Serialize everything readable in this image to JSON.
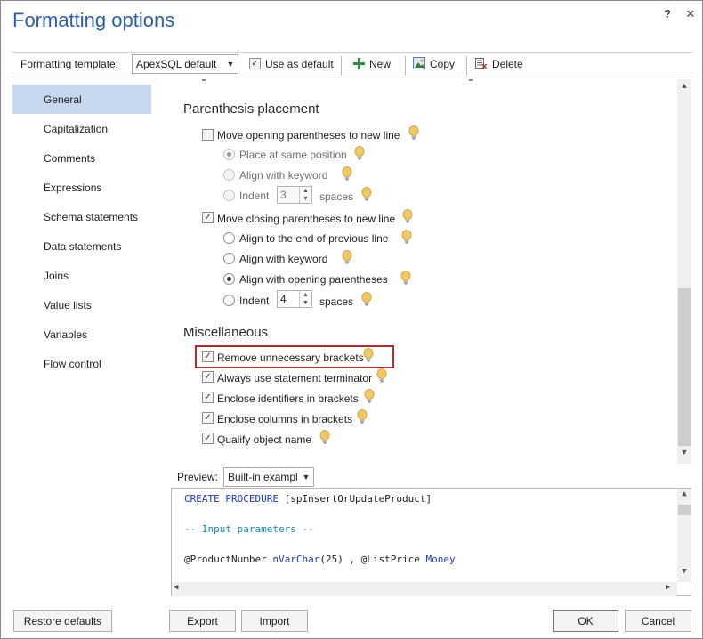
{
  "dialog": {
    "title": "Formatting options",
    "help_label": "?",
    "close_label": "✕"
  },
  "toolbar": {
    "template_label": "Formatting template:",
    "template_value": "ApexSQL default",
    "use_as_default_label": "Use as default",
    "use_as_default_checked": true,
    "new_label": "New",
    "copy_label": "Copy",
    "delete_label": "Delete"
  },
  "sidebar": {
    "items": [
      {
        "label": "General",
        "active": true
      },
      {
        "label": "Capitalization",
        "active": false
      },
      {
        "label": "Comments",
        "active": false
      },
      {
        "label": "Expressions",
        "active": false
      },
      {
        "label": "Schema statements",
        "active": false
      },
      {
        "label": "Data statements",
        "active": false
      },
      {
        "label": "Joins",
        "active": false
      },
      {
        "label": "Value lists",
        "active": false
      },
      {
        "label": "Variables",
        "active": false
      },
      {
        "label": "Flow control",
        "active": false
      }
    ]
  },
  "parenthesis": {
    "title": "Parenthesis placement",
    "open_new_line": {
      "label": "Move opening parentheses to new line",
      "checked": false
    },
    "open_same_position": {
      "label": "Place at same position",
      "selected": true,
      "disabled": true
    },
    "open_align_keyword": {
      "label": "Align with keyword",
      "selected": false,
      "disabled": true
    },
    "open_indent": {
      "label": "Indent",
      "value": "3",
      "unit": "spaces",
      "selected": false,
      "disabled": true
    },
    "close_new_line": {
      "label": "Move closing parentheses to new line",
      "checked": true
    },
    "close_end_prev_line": {
      "label": "Align to the end of previous line",
      "selected": false
    },
    "close_align_keyword": {
      "label": "Align with keyword",
      "selected": false
    },
    "close_align_opening": {
      "label": "Align with opening parentheses",
      "selected": true
    },
    "close_indent": {
      "label": "Indent",
      "value": "4",
      "unit": "spaces",
      "selected": false
    }
  },
  "misc": {
    "title": "Miscellaneous",
    "options": [
      {
        "label": "Remove unnecessary brackets",
        "checked": true
      },
      {
        "label": "Always use statement terminator",
        "checked": true
      },
      {
        "label": "Enclose identifiers in brackets",
        "checked": true
      },
      {
        "label": "Enclose columns in brackets",
        "checked": true
      },
      {
        "label": "Qualify object name",
        "checked": true
      }
    ]
  },
  "preview": {
    "label": "Preview:",
    "select_value": "Built-in exampl",
    "code": {
      "line1_kw": "CREATE PROCEDURE",
      "line1_rest": " [spInsertOrUpdateProduct]",
      "line2_comment": "-- Input parameters --",
      "line3_var1": "@ProductNumber ",
      "line3_type1": "nVarChar",
      "line3_mid": "(25) , @ListPrice ",
      "line3_type2": "Money"
    }
  },
  "buttons": {
    "restore_defaults": "Restore defaults",
    "export": "Export",
    "import": "Import",
    "ok": "OK",
    "cancel": "Cancel"
  },
  "colors": {
    "title": "#2a5fa8",
    "active_nav": "#c5d8ef",
    "highlight_box": "#b8282e",
    "keyword": "#1f39c9",
    "comment": "#1a8aa8"
  }
}
